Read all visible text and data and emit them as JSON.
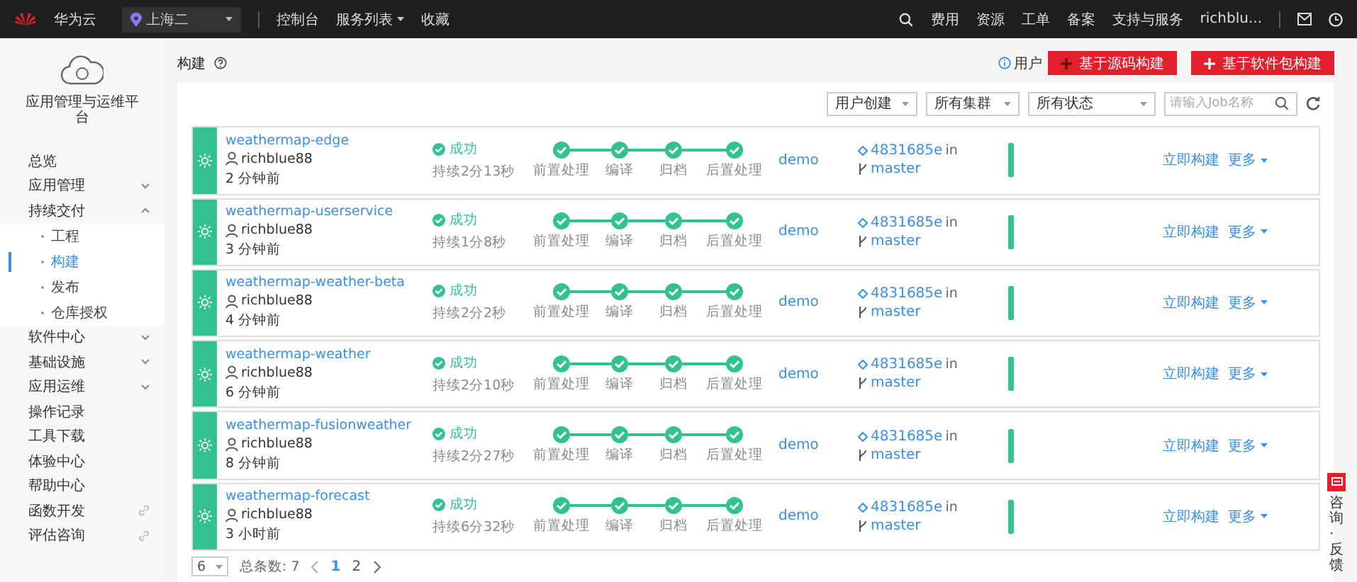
{
  "topbar": {
    "brand": "华为云",
    "region": "上海二",
    "nav": [
      {
        "label": "控制台",
        "dropdown": false
      },
      {
        "label": "服务列表",
        "dropdown": true
      },
      {
        "label": "收藏",
        "dropdown": false
      }
    ],
    "links": [
      "费用",
      "资源",
      "工单",
      "备案",
      "支持与服务"
    ],
    "user": "richblu..."
  },
  "sidebar": {
    "title": "应用管理与运维平台",
    "items": [
      {
        "label": "总览",
        "kind": "link",
        "selected": false
      },
      {
        "label": "应用管理",
        "kind": "group",
        "expanded": false,
        "selected": false
      },
      {
        "label": "持续交付",
        "kind": "group",
        "expanded": true,
        "selected": false,
        "children": [
          {
            "label": "工程",
            "selected": false
          },
          {
            "label": "构建",
            "selected": true
          },
          {
            "label": "发布",
            "selected": false
          },
          {
            "label": "仓库授权",
            "selected": false
          }
        ]
      },
      {
        "label": "软件中心",
        "kind": "group",
        "expanded": false,
        "selected": false
      },
      {
        "label": "基础设施",
        "kind": "group",
        "expanded": false,
        "selected": false
      },
      {
        "label": "应用运维",
        "kind": "group",
        "expanded": false,
        "selected": false
      },
      {
        "label": "操作记录",
        "kind": "link",
        "selected": false
      },
      {
        "label": "工具下载",
        "kind": "link",
        "selected": false
      },
      {
        "label": "体验中心",
        "kind": "link",
        "selected": false
      },
      {
        "label": "帮助中心",
        "kind": "link",
        "selected": false
      },
      {
        "label": "函数开发",
        "kind": "external",
        "selected": false
      },
      {
        "label": "评估咨询",
        "kind": "external",
        "selected": false
      }
    ]
  },
  "page": {
    "title": "构建",
    "guide": "用户",
    "actions": [
      "基于源码构建",
      "基于软件包构建"
    ]
  },
  "filters": [
    {
      "label": "用户创建"
    },
    {
      "label": "所有集群"
    },
    {
      "label": "所有状态"
    }
  ],
  "search": {
    "placeholder": "请输入Job名称"
  },
  "jobs": [
    {
      "name": "weathermap-edge",
      "user": "richblue88",
      "time": "2 分钟前",
      "status": {
        "kind": "success",
        "text": "成功"
      },
      "duration": "持续2分13秒",
      "steps": [
        {
          "label": "前置处理",
          "done": true
        },
        {
          "label": "编译",
          "done": true
        },
        {
          "label": "归档",
          "done": true
        },
        {
          "label": "后置处理",
          "done": true
        }
      ],
      "env": "demo",
      "commit": "4831685e",
      "commit_suffix": "in",
      "branch": "master",
      "actions": [
        "立即构建",
        "更多"
      ]
    },
    {
      "name": "weathermap-userservice",
      "user": "richblue88",
      "time": "3 分钟前",
      "status": {
        "kind": "success",
        "text": "成功"
      },
      "duration": "持续1分8秒",
      "steps": [
        {
          "label": "前置处理",
          "done": true
        },
        {
          "label": "编译",
          "done": true
        },
        {
          "label": "归档",
          "done": true
        },
        {
          "label": "后置处理",
          "done": true
        }
      ],
      "env": "demo",
      "commit": "4831685e",
      "commit_suffix": "in",
      "branch": "master",
      "actions": [
        "立即构建",
        "更多"
      ]
    },
    {
      "name": "weathermap-weather-beta",
      "user": "richblue88",
      "time": "4 分钟前",
      "status": {
        "kind": "success",
        "text": "成功"
      },
      "duration": "持续2分2秒",
      "steps": [
        {
          "label": "前置处理",
          "done": true
        },
        {
          "label": "编译",
          "done": true
        },
        {
          "label": "归档",
          "done": true
        },
        {
          "label": "后置处理",
          "done": true
        }
      ],
      "env": "demo",
      "commit": "4831685e",
      "commit_suffix": "in",
      "branch": "master",
      "actions": [
        "立即构建",
        "更多"
      ]
    },
    {
      "name": "weathermap-weather",
      "user": "richblue88",
      "time": "6 分钟前",
      "status": {
        "kind": "success",
        "text": "成功"
      },
      "duration": "持续2分10秒",
      "steps": [
        {
          "label": "前置处理",
          "done": true
        },
        {
          "label": "编译",
          "done": true
        },
        {
          "label": "归档",
          "done": true
        },
        {
          "label": "后置处理",
          "done": true
        }
      ],
      "env": "demo",
      "commit": "4831685e",
      "commit_suffix": "in",
      "branch": "master",
      "actions": [
        "立即构建",
        "更多"
      ]
    },
    {
      "name": "weathermap-fusionweather",
      "user": "richblue88",
      "time": "8 分钟前",
      "status": {
        "kind": "success",
        "text": "成功"
      },
      "duration": "持续2分27秒",
      "steps": [
        {
          "label": "前置处理",
          "done": true
        },
        {
          "label": "编译",
          "done": true
        },
        {
          "label": "归档",
          "done": true
        },
        {
          "label": "后置处理",
          "done": true
        }
      ],
      "env": "demo",
      "commit": "4831685e",
      "commit_suffix": "in",
      "branch": "master",
      "actions": [
        "立即构建",
        "更多"
      ]
    },
    {
      "name": "weathermap-forecast",
      "user": "richblue88",
      "time": "3 小时前",
      "status": {
        "kind": "success",
        "text": "成功"
      },
      "duration": "持续6分32秒",
      "steps": [
        {
          "label": "前置处理",
          "done": true
        },
        {
          "label": "编译",
          "done": true
        },
        {
          "label": "归档",
          "done": true
        },
        {
          "label": "后置处理",
          "done": true
        }
      ],
      "env": "demo",
      "commit": "4831685e",
      "commit_suffix": "in",
      "branch": "master",
      "actions": [
        "立即构建",
        "更多"
      ]
    }
  ],
  "pagination": {
    "page_size": "6",
    "total": "总条数: 7",
    "pages": [
      {
        "label": "1",
        "selected": true
      },
      {
        "label": "2",
        "selected": false
      }
    ]
  },
  "feedback": {
    "label": "咨询·反馈"
  }
}
